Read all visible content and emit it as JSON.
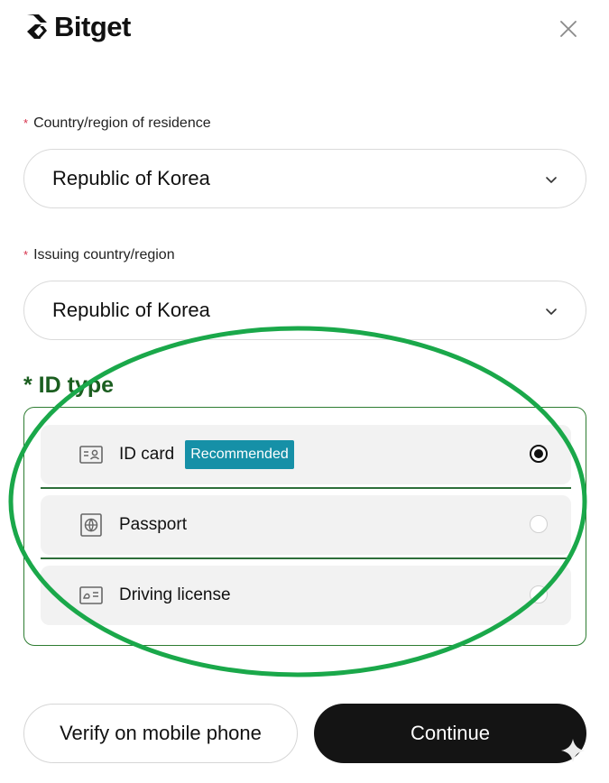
{
  "header": {
    "logo_text": "Bitget",
    "close_icon": "close-icon"
  },
  "residence": {
    "label": "Country/region of residence",
    "required_mark": "*",
    "value": "Republic of Korea"
  },
  "issuing": {
    "label": "Issuing country/region",
    "required_mark": "*",
    "value": "Republic of Korea"
  },
  "id_type": {
    "title": "* ID type",
    "options": [
      {
        "label": "ID card",
        "badge": "Recommended",
        "icon": "id-card-icon",
        "selected": true
      },
      {
        "label": "Passport",
        "icon": "passport-icon",
        "selected": false
      },
      {
        "label": "Driving license",
        "icon": "driving-license-icon",
        "selected": false
      }
    ]
  },
  "actions": {
    "verify_mobile_label": "Verify on mobile phone",
    "continue_label": "Continue"
  },
  "colors": {
    "accent_green": "#1aa84a",
    "badge_teal": "#1690a7",
    "required_red": "#d6304a",
    "primary_button": "#141414"
  }
}
